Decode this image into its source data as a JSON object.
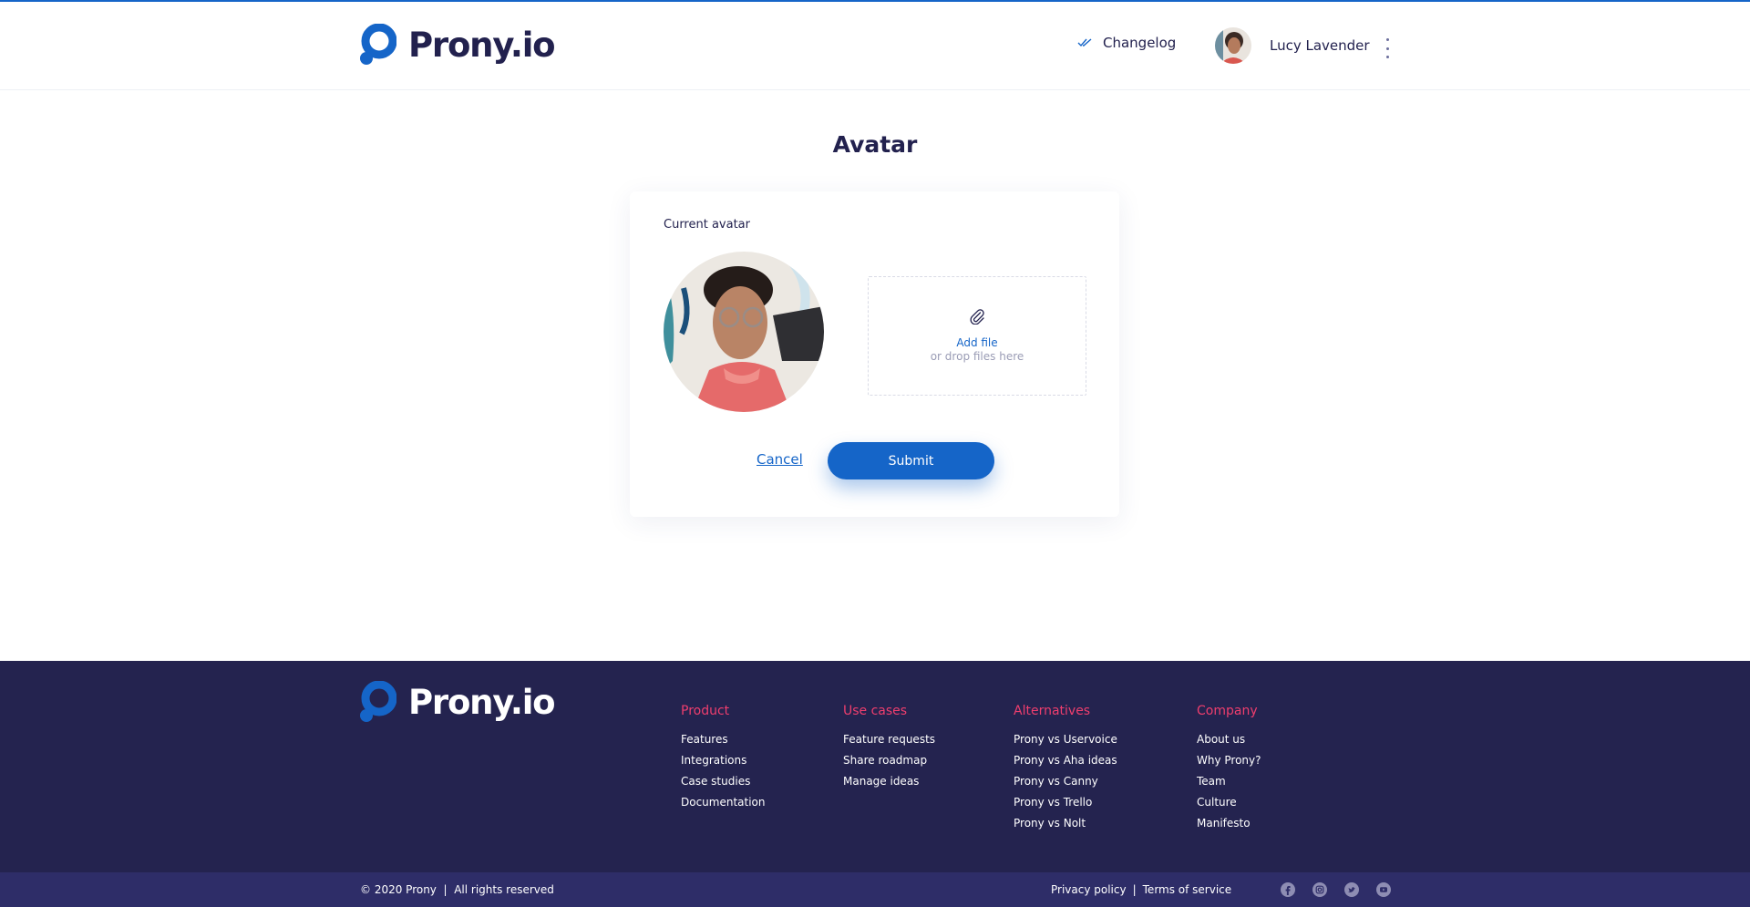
{
  "brand": {
    "name": "Prony.io",
    "accent": "#1565c8",
    "dark": "#22214e",
    "footer_bg": "#24234f",
    "footer_heading": "#ef3e6e"
  },
  "header": {
    "changelog_label": "Changelog",
    "user_name": "Lucy Lavender",
    "icons": [
      "double-check-icon",
      "avatar",
      "kebab-menu-icon"
    ]
  },
  "main": {
    "title": "Avatar",
    "current_label": "Current avatar",
    "dropzone": {
      "add_label": "Add file",
      "hint": "or drop files here",
      "icon": "paperclip-icon"
    },
    "cancel_label": "Cancel",
    "submit_label": "Submit"
  },
  "footer": {
    "columns": [
      {
        "heading": "Product",
        "items": [
          "Features",
          "Integrations",
          "Case studies",
          "Documentation"
        ]
      },
      {
        "heading": "Use cases",
        "items": [
          "Feature requests",
          "Share roadmap",
          "Manage ideas"
        ]
      },
      {
        "heading": "Alternatives",
        "items": [
          "Prony vs Uservoice",
          "Prony vs Aha ideas",
          "Prony vs Canny",
          "Prony vs Trello",
          "Prony vs Nolt"
        ]
      },
      {
        "heading": "Company",
        "items": [
          "About us",
          "Why Prony?",
          "Team",
          "Culture",
          "Manifesto"
        ]
      }
    ],
    "copyright": "© 2020 Prony  |  All rights reserved",
    "privacy": "Privacy policy",
    "separator": "|",
    "terms": "Terms of service",
    "social": [
      "facebook-icon",
      "instagram-icon",
      "twitter-icon",
      "youtube-icon"
    ]
  }
}
